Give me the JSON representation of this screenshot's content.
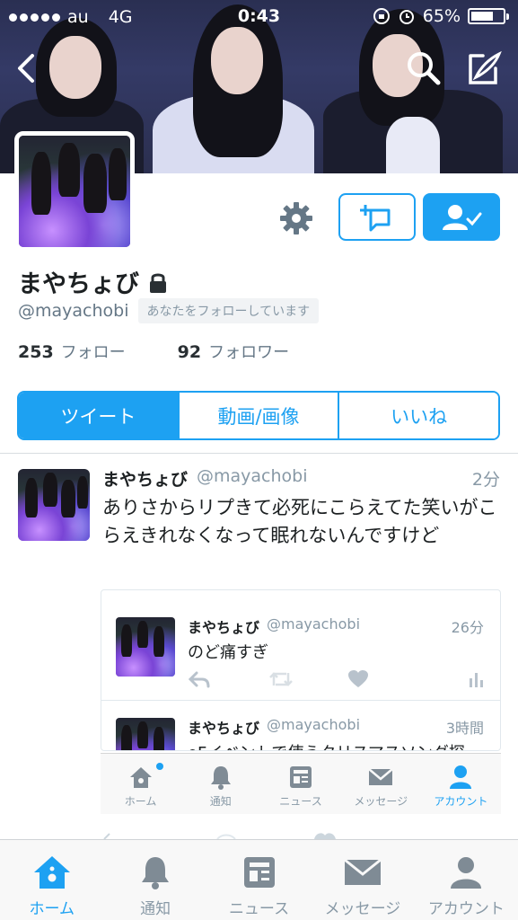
{
  "status_bar": {
    "carrier": "au",
    "network": "4G",
    "time": "0:43",
    "battery": "65%"
  },
  "profile": {
    "display_name": "まやちょび",
    "handle": "@mayachobi",
    "follows_you": "あなたをフォローしています",
    "following_count": "253",
    "following_label": "フォロー",
    "followers_count": "92",
    "followers_label": "フォロワー",
    "locked": true
  },
  "tabs": [
    {
      "label": "ツイート",
      "active": true
    },
    {
      "label": "動画/画像",
      "active": false
    },
    {
      "label": "いいね",
      "active": false
    }
  ],
  "tweet": {
    "name": "まやちょび",
    "handle": "@mayachobi",
    "time": "2分",
    "text": "ありさからリプきて必死にこらえてた笑いがこらえきれなくなって眠れないんですけど"
  },
  "embedded_tweets": [
    {
      "name": "まやちょび",
      "handle": "@mayachobi",
      "time": "26分",
      "text": "のど痛すぎ"
    },
    {
      "name": "まやちょび",
      "handle": "@mayachobi",
      "time": "3時間",
      "text": "oFイベントで使うクリスマスソング探"
    }
  ],
  "mini_tabbar": [
    {
      "label": "ホーム",
      "icon": "home-icon",
      "active": false
    },
    {
      "label": "通知",
      "icon": "bell-icon",
      "active": false
    },
    {
      "label": "ニュース",
      "icon": "news-icon",
      "active": false
    },
    {
      "label": "メッセージ",
      "icon": "envelope-icon",
      "active": false
    },
    {
      "label": "アカウント",
      "icon": "person-icon",
      "active": true
    }
  ],
  "tabbar": [
    {
      "label": "ホーム",
      "icon": "home-icon",
      "active": true
    },
    {
      "label": "通知",
      "icon": "bell-icon",
      "active": false
    },
    {
      "label": "ニュース",
      "icon": "news-icon",
      "active": false
    },
    {
      "label": "メッセージ",
      "icon": "envelope-icon",
      "active": false
    },
    {
      "label": "アカウント",
      "icon": "person-icon",
      "active": false
    }
  ],
  "colors": {
    "accent": "#1da1f2",
    "muted": "#8899a6",
    "text": "#1c2022"
  }
}
